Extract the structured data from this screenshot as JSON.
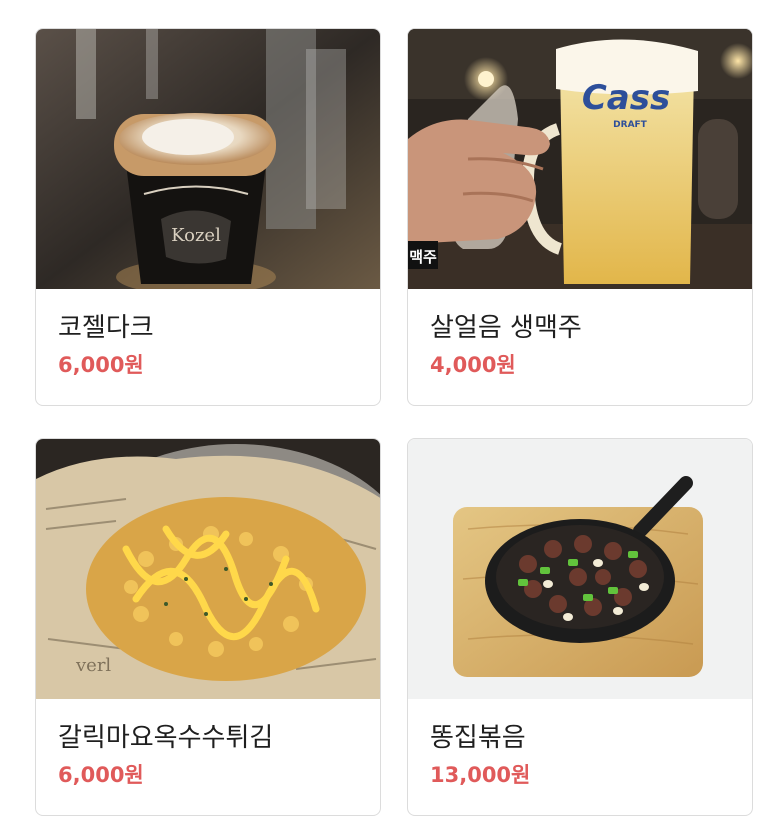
{
  "menu": {
    "items": [
      {
        "name": "코젤다크",
        "price": "6,000원",
        "image": "dark-beer-glass-photo"
      },
      {
        "name": "살얼음 생맥주",
        "price": "4,000원",
        "image": "draft-beer-mug-photo",
        "image_text": [
          "Cass",
          "DRAFT",
          "맥주"
        ]
      },
      {
        "name": "갈릭마요옥수수튀김",
        "price": "6,000원",
        "image": "garlic-mayo-corn-fries-photo"
      },
      {
        "name": "똥집볶음",
        "price": "13,000원",
        "image": "stir-fried-gizzard-skillet-photo"
      }
    ]
  },
  "colors": {
    "price": "#e05a5a",
    "name": "#1f1f1f",
    "card_border": "#dcdcdc"
  }
}
